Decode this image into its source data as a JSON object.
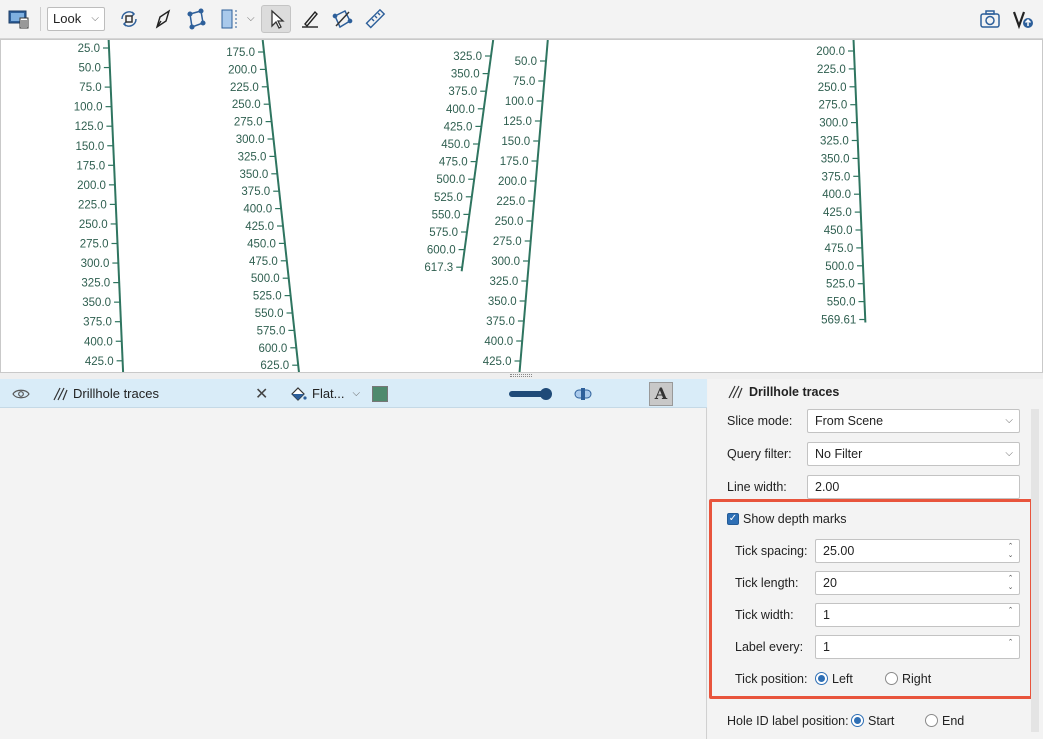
{
  "toolbar": {
    "view_select": "Look"
  },
  "scene": {
    "trace_color": "#2f7560",
    "label_color": "#2f5f50",
    "traces": [
      {
        "labels": [
          "25.0",
          "50.0",
          "75.0",
          "100.0",
          "125.0",
          "150.0",
          "175.0",
          "200.0",
          "225.0",
          "250.0",
          "275.0",
          "300.0",
          "325.0",
          "350.0",
          "375.0",
          "400.0",
          "425.0"
        ]
      },
      {
        "labels": [
          "175.0",
          "200.0",
          "225.0",
          "250.0",
          "275.0",
          "300.0",
          "325.0",
          "350.0",
          "375.0",
          "400.0",
          "425.0",
          "450.0",
          "475.0",
          "500.0",
          "525.0",
          "550.0",
          "575.0",
          "600.0",
          "625.0"
        ]
      },
      {
        "labels": [
          "325.0",
          "350.0",
          "375.0",
          "400.0",
          "425.0",
          "450.0",
          "475.0",
          "500.0",
          "525.0",
          "550.0",
          "575.0",
          "600.0",
          "617.3"
        ]
      },
      {
        "labels": [
          "50.0",
          "75.0",
          "100.0",
          "125.0",
          "150.0",
          "175.0",
          "200.0",
          "225.0",
          "250.0",
          "275.0",
          "300.0",
          "325.0",
          "350.0",
          "375.0",
          "400.0",
          "425.0"
        ]
      },
      {
        "labels": [
          "200.0",
          "225.0",
          "250.0",
          "275.0",
          "300.0",
          "325.0",
          "350.0",
          "375.0",
          "400.0",
          "425.0",
          "450.0",
          "475.0",
          "500.0",
          "525.0",
          "550.0",
          "569.61"
        ]
      }
    ]
  },
  "object_list": {
    "row": {
      "label": "Drillhole traces",
      "color_mode": "Flat...",
      "swatch_color": "#4e8a6d"
    }
  },
  "properties": {
    "title": "Drillhole traces",
    "slice_mode": {
      "label": "Slice mode:",
      "value": "From Scene"
    },
    "query_filter": {
      "label": "Query filter:",
      "value": "No Filter"
    },
    "line_width": {
      "label": "Line width:",
      "value": "2.00"
    },
    "show_depth_marks": {
      "label": "Show depth marks",
      "checked": true
    },
    "tick_spacing": {
      "label": "Tick spacing:",
      "value": "25.00"
    },
    "tick_length": {
      "label": "Tick length:",
      "value": "20"
    },
    "tick_width": {
      "label": "Tick width:",
      "value": "1"
    },
    "label_every": {
      "label": "Label every:",
      "value": "1"
    },
    "tick_position": {
      "label": "Tick position:",
      "options": [
        "Left",
        "Right"
      ],
      "selected": "Left"
    },
    "hole_id_label_position": {
      "label": "Hole ID label position:",
      "options": [
        "Start",
        "End"
      ],
      "selected": "Start"
    }
  },
  "highlight_color": "#e8543c"
}
